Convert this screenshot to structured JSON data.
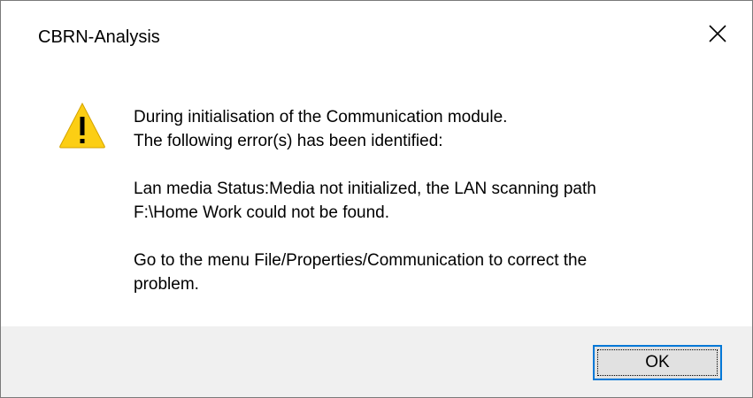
{
  "window": {
    "title": "CBRN-Analysis",
    "close_icon": "close-icon"
  },
  "message": {
    "icon": "warning-icon",
    "line1": "During initialisation of the Communication module.",
    "line2": "The following error(s) has been identified:",
    "error_line1": "Lan media Status:Media not initialized, the LAN scanning path",
    "error_line2": "F:\\Home Work could not be found.",
    "hint_line1": "Go to the menu File/Properties/Communication to correct the",
    "hint_line2": "problem."
  },
  "buttons": {
    "ok_label": "OK"
  },
  "colors": {
    "accent": "#0078d7",
    "warning_fill": "#fcce14",
    "footer_bg": "#f0f0f0"
  }
}
